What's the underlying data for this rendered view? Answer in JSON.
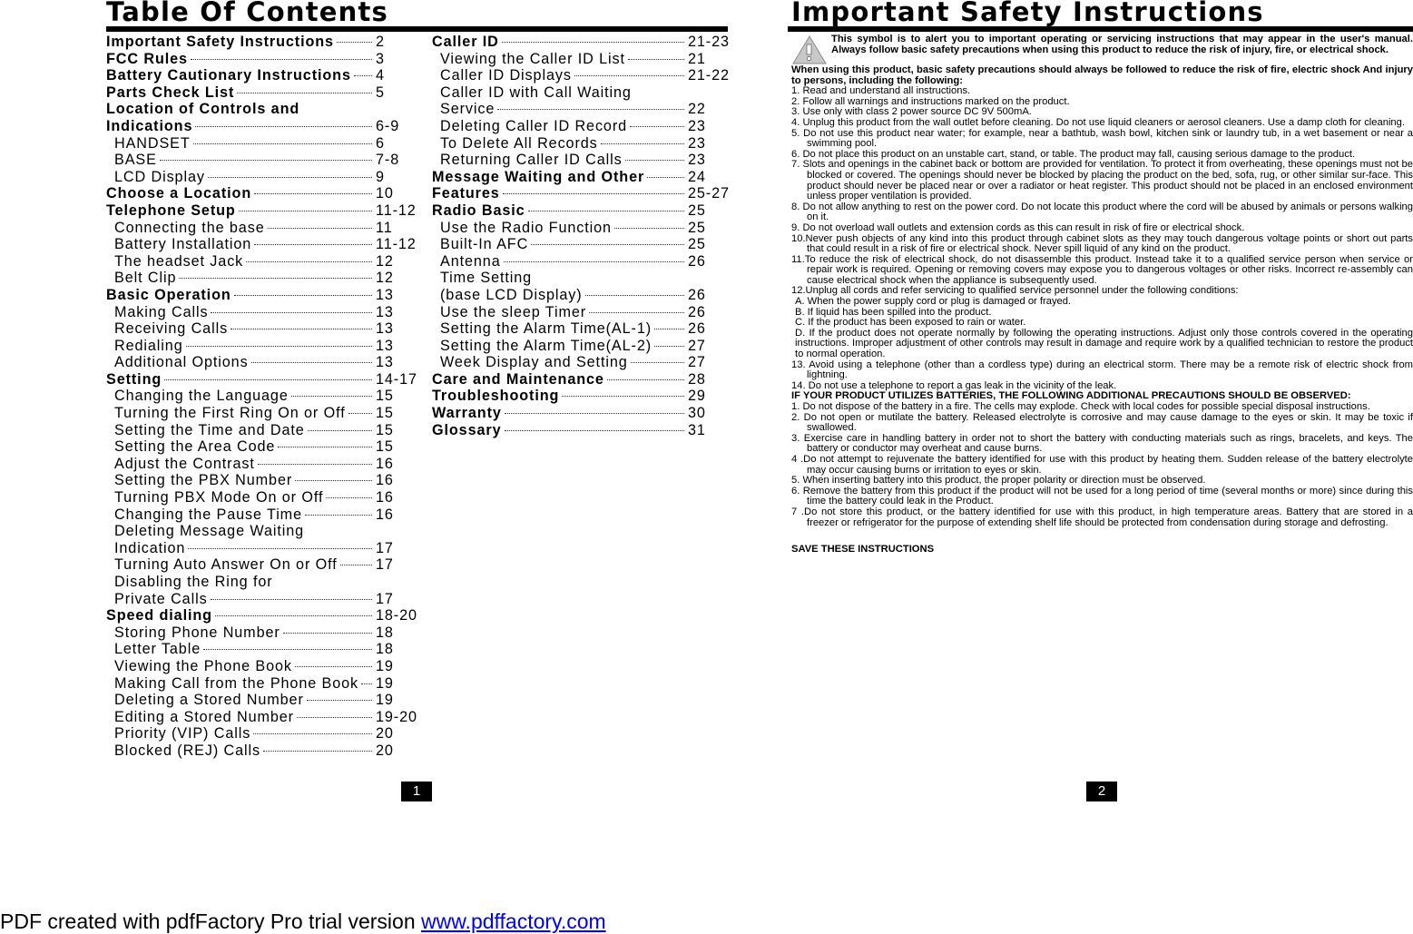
{
  "left_page": {
    "title": "Table Of Contents",
    "page_number": "1",
    "toc_columns": [
      [
        {
          "label": "Important Safety Instructions",
          "page": "2",
          "level": "major"
        },
        {
          "label": "FCC Rules",
          "page": "3",
          "level": "major"
        },
        {
          "label": "Battery Cautionary Instructions",
          "page": "4",
          "level": "major"
        },
        {
          "label": "Parts Check List",
          "page": "5",
          "level": "major"
        },
        {
          "label": "Location of Controls and",
          "page": "",
          "level": "major",
          "wrap": true
        },
        {
          "label": "Indications",
          "page": "6-9",
          "level": "major"
        },
        {
          "label": "HANDSET",
          "page": "6",
          "level": "minor"
        },
        {
          "label": "BASE",
          "page": "7-8",
          "level": "minor"
        },
        {
          "label": "LCD Display",
          "page": "9",
          "level": "minor"
        },
        {
          "label": "Choose a Location",
          "page": "10",
          "level": "major"
        },
        {
          "label": "Telephone Setup",
          "page": "11-12",
          "level": "major"
        },
        {
          "label": "Connecting the base",
          "page": "11",
          "level": "minor"
        },
        {
          "label": "Battery Installation",
          "page": "11-12",
          "level": "minor"
        },
        {
          "label": "The headset Jack",
          "page": "12",
          "level": "minor"
        },
        {
          "label": "Belt Clip",
          "page": "12",
          "level": "minor"
        },
        {
          "label": "Basic Operation",
          "page": "13",
          "level": "major"
        },
        {
          "label": "Making Calls",
          "page": "13",
          "level": "minor"
        },
        {
          "label": "Receiving Calls",
          "page": "13",
          "level": "minor"
        },
        {
          "label": "Redialing",
          "page": "13",
          "level": "minor"
        },
        {
          "label": "Additional Options",
          "page": "13",
          "level": "minor"
        },
        {
          "label": "Setting",
          "page": "14-17",
          "level": "major"
        },
        {
          "label": "Changing the Language",
          "page": "15",
          "level": "minor"
        },
        {
          "label": "Turning the First Ring On or Off",
          "page": "15",
          "level": "minor"
        },
        {
          "label": "Setting the Time and Date",
          "page": "15",
          "level": "minor"
        },
        {
          "label": "Setting the Area Code",
          "page": "15",
          "level": "minor"
        },
        {
          "label": "Adjust the Contrast",
          "page": "16",
          "level": "minor"
        },
        {
          "label": "Setting the PBX Number",
          "page": "16",
          "level": "minor"
        },
        {
          "label": "Turning PBX Mode On or Off",
          "page": "16",
          "level": "minor"
        },
        {
          "label": "Changing the Pause Time",
          "page": "16",
          "level": "minor"
        },
        {
          "label": "Deleting Message Waiting",
          "page": "",
          "level": "minor",
          "wrap": true
        },
        {
          "label": "Indication",
          "page": "17",
          "level": "minor"
        },
        {
          "label": "Turning Auto Answer On or Off",
          "page": "17",
          "level": "minor"
        },
        {
          "label": "Disabling the Ring for",
          "page": "",
          "level": "minor",
          "wrap": true
        },
        {
          "label": "Private Calls",
          "page": "17",
          "level": "minor"
        },
        {
          "label": "Speed dialing",
          "page": "18-20",
          "level": "major"
        },
        {
          "label": "Storing Phone Number",
          "page": "18",
          "level": "minor"
        },
        {
          "label": "Letter Table",
          "page": "18",
          "level": "minor"
        },
        {
          "label": "Viewing the Phone Book",
          "page": "19",
          "level": "minor"
        },
        {
          "label": "Making Call from the Phone Book",
          "page": "19",
          "level": "minor"
        },
        {
          "label": "Deleting a Stored Number",
          "page": "19",
          "level": "minor"
        },
        {
          "label": "Editing a Stored Number",
          "page": "19-20",
          "level": "minor"
        },
        {
          "label": "Priority (VIP) Calls",
          "page": "20",
          "level": "minor"
        },
        {
          "label": "Blocked (REJ) Calls",
          "page": "20",
          "level": "minor"
        }
      ],
      [
        {
          "label": "Caller ID",
          "page": "21-23",
          "level": "major"
        },
        {
          "label": "Viewing the Caller ID List",
          "page": "21",
          "level": "minor"
        },
        {
          "label": "Caller ID Displays",
          "page": "21-22",
          "level": "minor"
        },
        {
          "label": "Caller ID with Call Waiting",
          "page": "",
          "level": "minor",
          "wrap": true
        },
        {
          "label": "Service",
          "page": "22",
          "level": "minor"
        },
        {
          "label": "Deleting Caller ID Record",
          "page": "23",
          "level": "minor"
        },
        {
          "label": "To Delete All Records",
          "page": "23",
          "level": "minor"
        },
        {
          "label": "Returning Caller ID Calls",
          "page": "23",
          "level": "minor"
        },
        {
          "label": "Message Waiting and Other",
          "page": "24",
          "level": "major"
        },
        {
          "label": "Features",
          "page": "25-27",
          "level": "major"
        },
        {
          "label": "Radio Basic",
          "page": "25",
          "level": "major"
        },
        {
          "label": "Use the Radio Function",
          "page": "25",
          "level": "minor"
        },
        {
          "label": "Built-In AFC",
          "page": "25",
          "level": "minor"
        },
        {
          "label": "Antenna",
          "page": "26",
          "level": "minor"
        },
        {
          "label": "Time Setting",
          "page": "",
          "level": "minor",
          "wrap": true
        },
        {
          "label": "(base  LCD Display)",
          "page": "26",
          "level": "minor"
        },
        {
          "label": "Use the sleep Timer",
          "page": "26",
          "level": "minor"
        },
        {
          "label": "Setting the Alarm Time(AL-1)",
          "page": "26",
          "level": "minor"
        },
        {
          "label": "Setting the Alarm Time(AL-2)",
          "page": "27",
          "level": "minor"
        },
        {
          "label": "Week Display and Setting",
          "page": "27",
          "level": "minor"
        },
        {
          "label": "Care and Maintenance",
          "page": "28",
          "level": "major"
        },
        {
          "label": "Troubleshooting",
          "page": "29",
          "level": "major"
        },
        {
          "label": "Warranty",
          "page": "30",
          "level": "major"
        },
        {
          "label": "Glossary",
          "page": "31",
          "level": "major"
        }
      ]
    ]
  },
  "right_page": {
    "title": "Important Safety Instructions",
    "page_number": "2",
    "warning_icon": "warning-triangle-icon",
    "intro": "This symbol is to alert you to important  operating  or servicing  instructions  that  may appear in the  user's manual. Always follow basic safety precautions when using this product to reduce the risk of  injury, fire, or electrical shock.",
    "lead": "When using this product, basic  safety  precautions  should  always  be followed to reduce the risk of fire, electric shock And  injury to persons, including the following:",
    "items": [
      "1.  Read and understand all instructions.",
      "2.  Follow all warnings and instructions marked on the product.",
      "3.  Use only with class 2 power source DC 9V 500mA.",
      "4.  Unplug this product from the wall outlet before cleaning. Do not use liquid cleaners or aerosol cleaners.  Use a damp cloth  for cleaning.",
      "5. Do not use this product near water; for example, near a bathtub, wash bowl, kitchen sink or laundry tub,   in a wet basement  or  near a swimming pool.",
      "6. Do not place this product on an unstable cart, stand, or table. The product may fall, causing serious damage to the product.",
      "7. Slots and openings in the cabinet back or bottom are provided for ventilation. To protect it from overheating, these openings must not be blocked or covered. The openings should never be blocked by placing the product on the bed, sofa, rug, or other similar sur-face. This product should never be placed near or over a radiator or heat  register.  This  product  should  not  be  placed  in  an  enclosed  environment  unless  proper  ventilation  is provided.",
      "8. Do not allow anything to rest on the power cord. Do not locate this product where the cord will be abused by animals or persons walking on it.",
      "9. Do not overload wall outlets and extension cords as this can result in risk of fire or electrical shock.",
      "10.Never push objects of any kind into this product through cabinet slots as they may touch dangerous voltage points or short out parts that could result in a risk of fire or electrical shock. Never spill liquid of any kind on the product.",
      "11.To reduce the risk of electrical shock, do not disassemble this product. Instead take it to a qualified service person when service or repair work is required. Opening or removing covers  may expose you to dangerous voltages or other risks. Incorrect re-assembly can cause electrical shock when the appliance is subsequently used.",
      "12.Unplug all cords and refer servicing to qualified service personnel under the following conditions:"
    ],
    "subitems": [
      "A. When the power supply cord or plug is damaged or frayed.",
      "B. If liquid has been spilled into the product.",
      "C. If the product has been exposed to rain or water.",
      "D. If the product does not operate normally by following the operating instructions. Adjust only those controls covered in the operating instructions. Improper adjustment of other controls may result in damage and require work by a qualified technician to restore the product to normal operation."
    ],
    "items_after": [
      "13. Avoid using a telephone (other than a cordless type) during an electrical storm. There may be a remote risk of electric shock from lightning.",
      "14. Do not use a telephone to report a gas leak in the vicinity of the leak."
    ],
    "battery_heading": "IF YOUR PRODUCT UTILIZES BATTERIES, THE FOLLOWING ADDITIONAL PRECAUTIONS SHOULD BE OBSERVED:",
    "battery_items": [
      "1. Do not dispose of the battery in a fire. The cells may explode. Check with local codes  for possible special disposal instructions.",
      "2. Do not open or mutilate the battery. Released electrolyte is corrosive and may cause  damage to the eyes or skin. It may be toxic if swallowed.",
      "3. Exercise care in handling battery in order not to short the battery with conducting materials such as rings, bracelets, and keys. The battery or conductor may overheat  and cause burns.",
      "4 .Do not attempt to rejuvenate the battery identified for use with this product by heating them. Sudden release of the battery electrolyte may occur causing burns or irritation to eyes or skin.",
      "5. When inserting battery into this product, the proper polarity or direction must be observed.",
      "6. Remove the battery from this product if the product will not be used for a long period of time (several months or more) since during this time the battery could leak in the Product.",
      "7 .Do not store this product, or the battery identified for use with this product, in high temperature areas. Battery that are stored in a freezer or refrigerator for the purpose of extending shelf life should be protected from condensation during storage and defrosting."
    ],
    "closing": "SAVE THESE INSTRUCTIONS"
  },
  "footer": {
    "text": "PDF created with pdfFactory Pro trial version ",
    "link_text": "www.pdffactory.com",
    "link_color": "#0000ee"
  }
}
